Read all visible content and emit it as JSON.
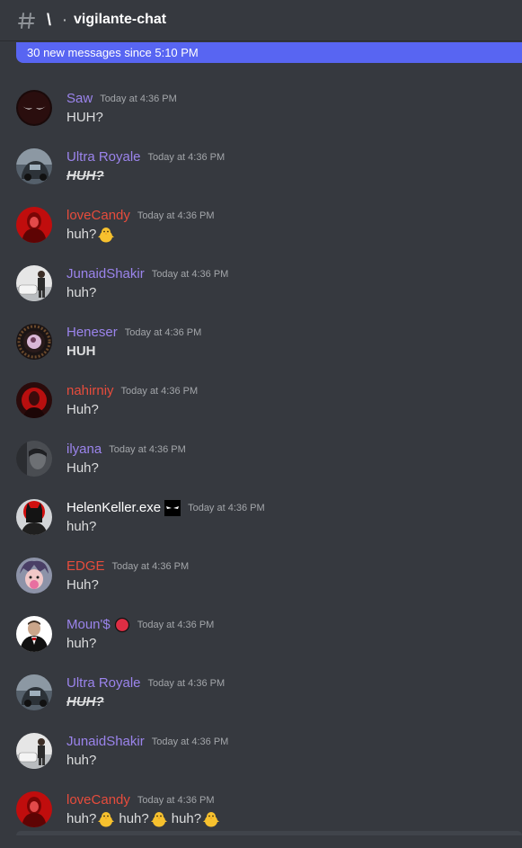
{
  "header": {
    "channel_name": "vigilante-chat",
    "channel_icon": "\\",
    "icons": [
      "hash-icon"
    ]
  },
  "banner": {
    "text": "30 new messages since 5:10 PM",
    "color": "#5865f2"
  },
  "colors": {
    "purple_name": "#9b84ec",
    "red_name": "#e74c3c",
    "white_name": "#ffffff",
    "timestamp": "#a3a6aa",
    "message_text": "#dcddde",
    "background": "#36393f"
  },
  "messages": [
    {
      "username": "Saw",
      "timestamp": "Today at 4:36 PM",
      "parts": [
        "HUH?"
      ],
      "style": "normal",
      "name_color": "#9b84ec",
      "avatar": "dark-eyes"
    },
    {
      "username": "Ultra Royale",
      "timestamp": "Today at 4:36 PM",
      "parts": [
        "HUH?"
      ],
      "style": "strike-italic",
      "name_color": "#9b84ec",
      "avatar": "car"
    },
    {
      "username": "loveCandy",
      "timestamp": "Today at 4:36 PM",
      "parts": [
        "huh?"
      ],
      "style": "normal",
      "name_color": "#e74c3c",
      "avatar": "red-girl",
      "emoji_after_each": "chick-icon"
    },
    {
      "username": "JunaidShakir",
      "timestamp": "Today at 4:36 PM",
      "parts": [
        "huh?"
      ],
      "style": "normal",
      "name_color": "#9b84ec",
      "avatar": "man-car"
    },
    {
      "username": "Heneser",
      "timestamp": "Today at 4:36 PM",
      "parts": [
        "HUH"
      ],
      "style": "bold",
      "name_color": "#9b84ec",
      "avatar": "ring"
    },
    {
      "username": "nahirniy",
      "timestamp": "Today at 4:36 PM",
      "parts": [
        "Huh?"
      ],
      "style": "normal",
      "name_color": "#e74c3c",
      "avatar": "red-dark"
    },
    {
      "username": "ilyana",
      "timestamp": "Today at 4:36 PM",
      "parts": [
        "Huh?"
      ],
      "style": "normal",
      "name_color": "#9b84ec",
      "avatar": "grey-face"
    },
    {
      "username": "HelenKeller.exe",
      "timestamp": "Today at 4:36 PM",
      "parts": [
        "huh?"
      ],
      "style": "normal",
      "name_color": "#ffffff",
      "avatar": "batman",
      "name_emoji": "eyes-icon"
    },
    {
      "username": "EDGE",
      "timestamp": "Today at 4:36 PM",
      "parts": [
        "Huh?"
      ],
      "style": "normal",
      "name_color": "#e74c3c",
      "avatar": "anime"
    },
    {
      "username": "Moun'$",
      "timestamp": "Today at 4:36 PM",
      "parts": [
        "huh?"
      ],
      "style": "normal",
      "name_color": "#9b84ec",
      "avatar": "godfather",
      "name_emoji": "red-circle-icon"
    },
    {
      "username": "Ultra Royale",
      "timestamp": "Today at 4:36 PM",
      "parts": [
        "HUH?"
      ],
      "style": "strike-italic",
      "name_color": "#9b84ec",
      "avatar": "car"
    },
    {
      "username": "JunaidShakir",
      "timestamp": "Today at 4:36 PM",
      "parts": [
        "huh?"
      ],
      "style": "normal",
      "name_color": "#9b84ec",
      "avatar": "man-car"
    },
    {
      "username": "loveCandy",
      "timestamp": "Today at 4:36 PM",
      "parts": [
        "huh?",
        "huh?",
        "huh?"
      ],
      "style": "normal",
      "name_color": "#e74c3c",
      "avatar": "red-girl",
      "emoji_after_each": "chick-icon"
    }
  ]
}
